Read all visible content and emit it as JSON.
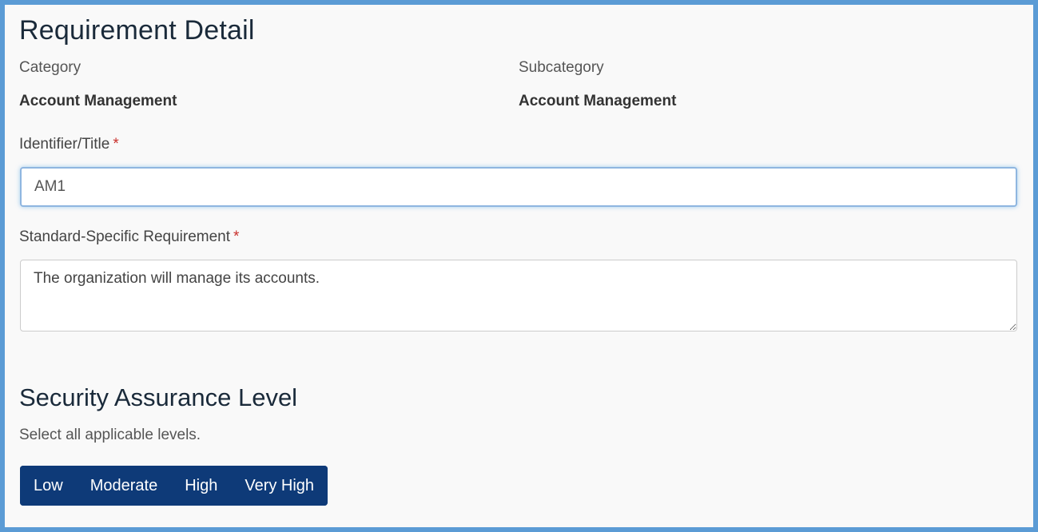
{
  "page": {
    "title": "Requirement Detail"
  },
  "meta": {
    "category_label": "Category",
    "category_value": "Account Management",
    "subcategory_label": "Subcategory",
    "subcategory_value": "Account Management"
  },
  "form": {
    "identifier_label": "Identifier/Title",
    "identifier_value": "AM1",
    "requirement_label": "Standard-Specific Requirement",
    "requirement_value": "The organization will manage its accounts.",
    "required_marker": "*"
  },
  "assurance": {
    "title": "Security Assurance Level",
    "hint": "Select all applicable levels.",
    "levels": [
      "Low",
      "Moderate",
      "High",
      "Very High"
    ]
  },
  "colors": {
    "frame_border": "#5b9bd5",
    "button_bg": "#0e3a78",
    "required": "#c9302c"
  }
}
